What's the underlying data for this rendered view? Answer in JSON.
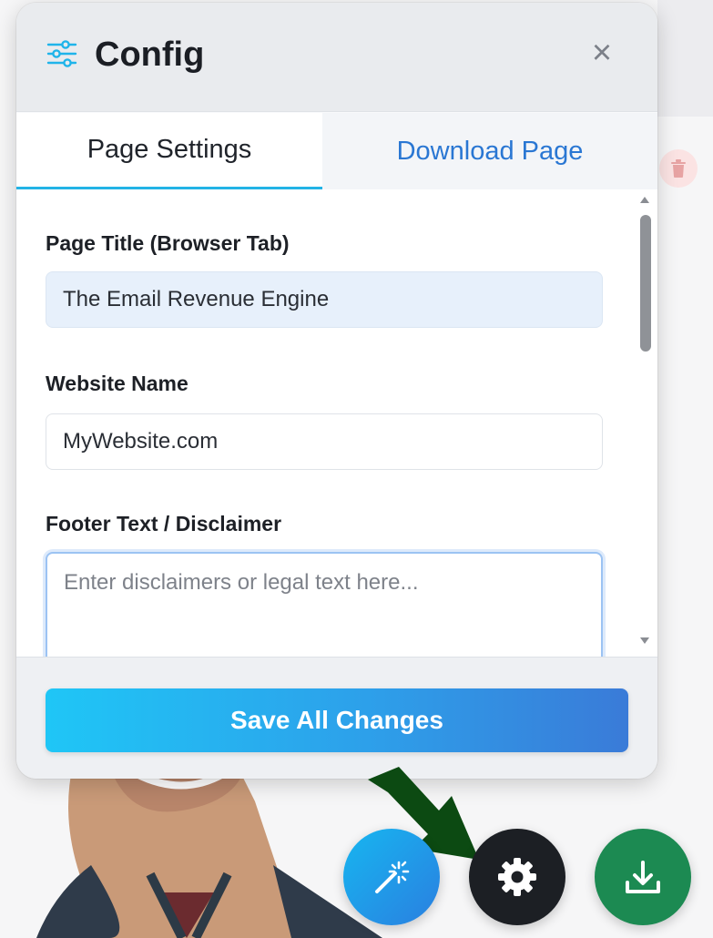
{
  "panel": {
    "title": "Config",
    "icon": "sliders-icon",
    "close_glyph": "×"
  },
  "tabs": [
    {
      "label": "Page Settings",
      "active": true
    },
    {
      "label": "Download Page",
      "active": false
    }
  ],
  "fields": {
    "page_title": {
      "label": "Page Title (Browser Tab)",
      "value": "The Email Revenue Engine"
    },
    "website_name": {
      "label": "Website Name",
      "value": "MyWebsite.com"
    },
    "footer_text": {
      "label": "Footer Text / Disclaimer",
      "value": "",
      "placeholder": "Enter disclaimers or legal text here..."
    }
  },
  "footer": {
    "save_label": "Save All Changes"
  },
  "fabs": [
    {
      "icon": "magic-wand-icon",
      "color": "#17b6f0"
    },
    {
      "icon": "gear-icon",
      "color": "#1c1f24"
    },
    {
      "icon": "download-icon",
      "color": "#1c8a52"
    }
  ],
  "colors": {
    "accent": "#22b3e6",
    "link": "#2a77d3",
    "annotation_arrow": "#0c4a12"
  }
}
